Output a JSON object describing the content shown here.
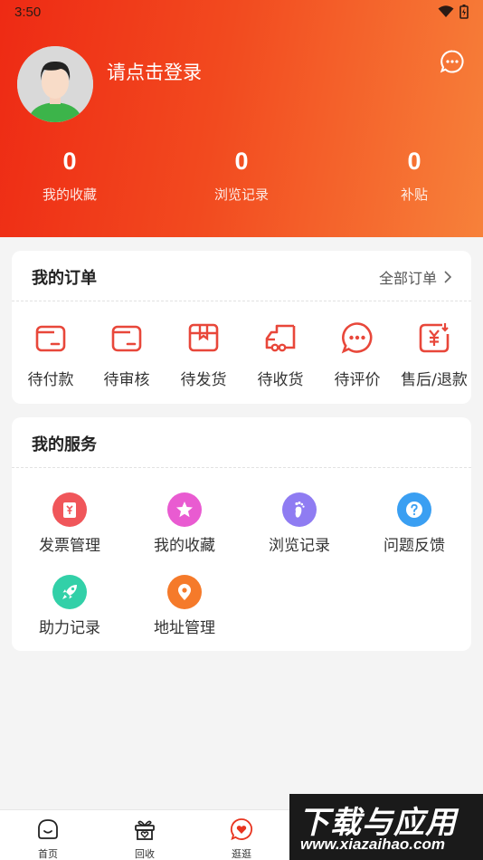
{
  "status_bar": {
    "time": "3:50"
  },
  "profile": {
    "login_text": "请点击登录"
  },
  "stats": [
    {
      "value": "0",
      "label": "我的收藏"
    },
    {
      "value": "0",
      "label": "浏览记录"
    },
    {
      "value": "0",
      "label": "补贴"
    }
  ],
  "orders": {
    "title": "我的订单",
    "all_link": "全部订单",
    "items": [
      {
        "label": "待付款",
        "icon": "wallet-icon"
      },
      {
        "label": "待审核",
        "icon": "review-icon"
      },
      {
        "label": "待发货",
        "icon": "package-icon"
      },
      {
        "label": "待收货",
        "icon": "truck-icon"
      },
      {
        "label": "待评价",
        "icon": "comment-icon"
      },
      {
        "label": "售后/退款",
        "icon": "refund-icon"
      }
    ]
  },
  "services": {
    "title": "我的服务",
    "items": [
      {
        "label": "发票管理",
        "icon": "invoice-icon",
        "color": "#f0565a"
      },
      {
        "label": "我的收藏",
        "icon": "star-icon",
        "color": "#e95bd1"
      },
      {
        "label": "浏览记录",
        "icon": "footprint-icon",
        "color": "#8f7cf2"
      },
      {
        "label": "问题反馈",
        "icon": "question-icon",
        "color": "#3a9ff2"
      },
      {
        "label": "助力记录",
        "icon": "rocket-icon",
        "color": "#32d0a8"
      },
      {
        "label": "地址管理",
        "icon": "location-icon",
        "color": "#f57a2a"
      }
    ]
  },
  "tabbar": [
    {
      "label": "首页",
      "icon": "home-icon"
    },
    {
      "label": "回收",
      "icon": "recycle-gift-icon"
    },
    {
      "label": "逛逛",
      "icon": "heart-bubble-icon"
    }
  ],
  "watermark": {
    "text": "下载与应用",
    "url": "www.xiazaihao.com"
  },
  "colors": {
    "brand": "#f03c1e",
    "accent": "#e8473a"
  }
}
